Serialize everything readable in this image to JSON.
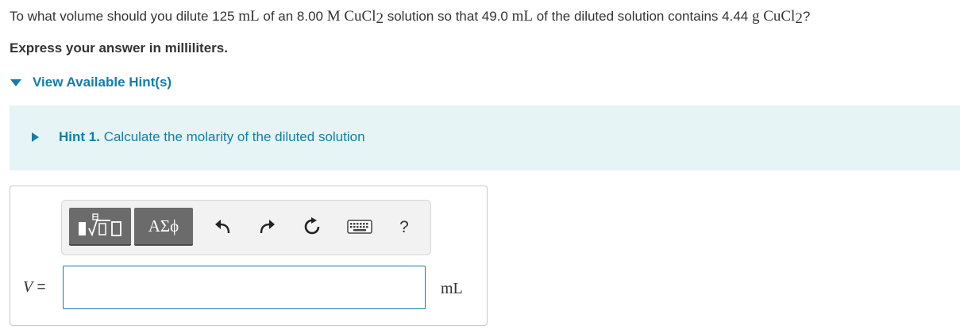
{
  "question": {
    "p1": "To what volume should you dilute 125 ",
    "mL": "mL",
    "p2": " of an 8.00 ",
    "M": "M",
    "cucl": "CuCl",
    "sub2": "2",
    "p3": " solution so that 49.0 ",
    "p4": " of the diluted solution contains 4.44 ",
    "g": "g",
    "qmark": "?"
  },
  "instruction": "Express your answer in milliliters.",
  "hints": {
    "toggle_label": "View Available Hint(s)",
    "items": [
      {
        "number_label": "Hint 1.",
        "text": "Calculate the molarity of the diluted solution"
      }
    ]
  },
  "toolbar": {
    "symbols_label": "ΑΣϕ",
    "help_label": "?",
    "icons": [
      "templates-icon",
      "undo-icon",
      "redo-icon",
      "reset-icon",
      "keyboard-icon"
    ]
  },
  "answer": {
    "variable": "V",
    "equals": " =",
    "value": "",
    "unit": "mL"
  },
  "colors": {
    "accent": "#137ea8",
    "hint_bg": "#e6f4f5",
    "tool_button": "#6b6b6b"
  }
}
